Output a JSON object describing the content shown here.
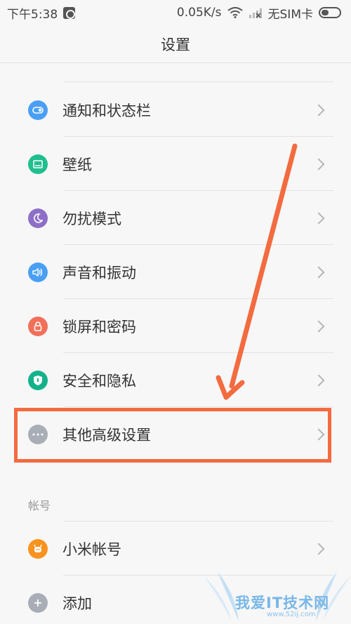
{
  "status_bar": {
    "time": "下午5:38",
    "speed": "0.05K/s",
    "sim": "无SIM卡"
  },
  "title": "设置",
  "items": [
    {
      "label": "通知和状态栏",
      "icon": "notification-toggle-icon",
      "color": "#4a9ff5"
    },
    {
      "label": "壁纸",
      "icon": "wallpaper-icon",
      "color": "#1fbf8f"
    },
    {
      "label": "勿扰模式",
      "icon": "moon-icon",
      "color": "#8e6fc8"
    },
    {
      "label": "声音和振动",
      "icon": "speaker-icon",
      "color": "#4a9ff5"
    },
    {
      "label": "锁屏和密码",
      "icon": "lock-icon",
      "color": "#f2705a"
    },
    {
      "label": "安全和隐私",
      "icon": "shield-icon",
      "color": "#14b28a"
    },
    {
      "label": "其他高级设置",
      "icon": "more-dots-icon",
      "color": "#a9aeb6"
    }
  ],
  "section_account": "帐号",
  "account_items": [
    {
      "label": "小米帐号",
      "icon": "mi-account-icon",
      "color": "#f7931e"
    },
    {
      "label": "添加",
      "icon": "add-icon",
      "color": "#a9aeb6"
    }
  ],
  "annotation_color": "#f36b3f",
  "watermark": {
    "text": "我爱IT技术网",
    "url": "www.52ij.com"
  }
}
